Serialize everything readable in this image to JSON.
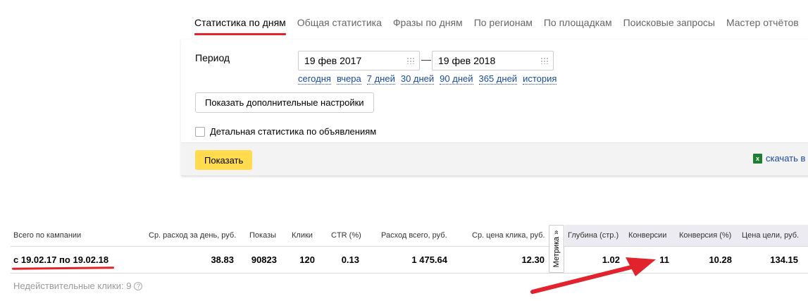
{
  "tabs": [
    {
      "label": "Статистика по дням",
      "active": true
    },
    {
      "label": "Общая статистика"
    },
    {
      "label": "Фразы по дням"
    },
    {
      "label": "По регионам"
    },
    {
      "label": "По площадкам"
    },
    {
      "label": "Поисковые запросы"
    },
    {
      "label": "Мастер отчётов"
    }
  ],
  "period": {
    "label": "Период",
    "date_from": "19 фев 2017",
    "date_to": "19 фев 2018",
    "separator": "—",
    "quick_links": [
      "сегодня",
      "вчера",
      "7 дней",
      "30 дней",
      "90 дней",
      "365 дней",
      "история"
    ]
  },
  "more_settings_label": "Показать дополнительные настройки",
  "detail_checkbox_label": "Детальная статистика по объявлениям",
  "show_button_label": "Показать",
  "download_label": "скачать в",
  "table": {
    "headers": {
      "campaign": "Всего по кампании",
      "avg_spend": "Ср. расход за день, руб.",
      "impressions": "Показы",
      "clicks": "Клики",
      "ctr": "CTR (%)",
      "total_spend": "Расход всего, руб.",
      "avg_cpc": "Ср. цена клика, руб.",
      "depth": "Глубина (стр.)",
      "conversions": "Конверсии",
      "conv_rate": "Конверсия (%)",
      "goal_price": "Цена цели, руб."
    },
    "metrika_label": "Метрика »",
    "row": {
      "range": "с 19.02.17 по 19.02.18",
      "avg_spend": "38.83",
      "impressions": "90823",
      "clicks": "120",
      "ctr": "0.13",
      "total_spend": "1 475.64",
      "avg_cpc": "12.30",
      "depth": "1.02",
      "conversions": "11",
      "conv_rate": "10.28",
      "goal_price": "134.15"
    }
  },
  "invalid_clicks": "Недействительные клики: 9",
  "accent_colors": {
    "red": "#e2222c",
    "yellow": "#ffdb4d",
    "link": "#1a4aa3"
  }
}
